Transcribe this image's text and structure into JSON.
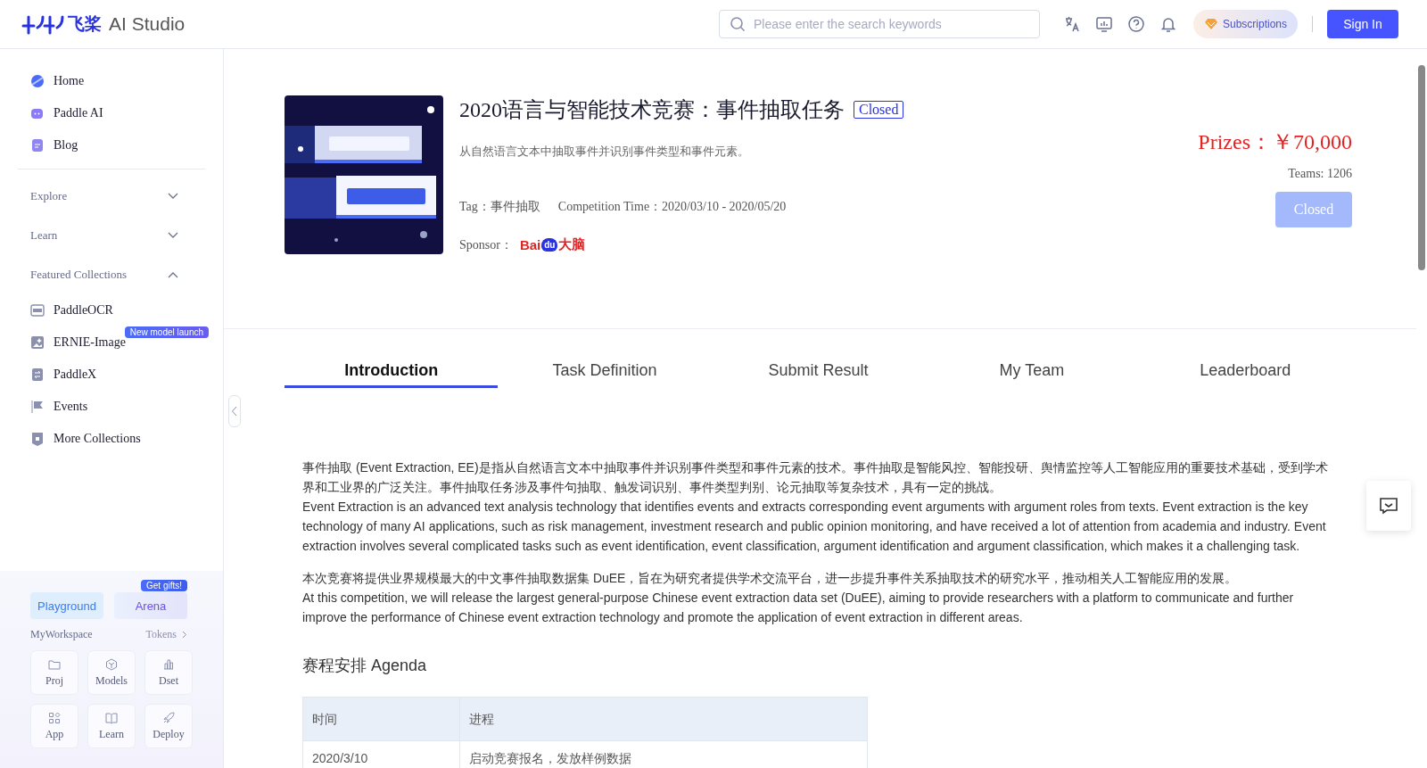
{
  "header": {
    "logo_cn": "飞桨",
    "logo_en": "AI Studio",
    "search": {
      "placeholder": "Please enter the search keywords"
    },
    "subscriptions": "Subscriptions",
    "sign_in": "Sign In"
  },
  "sidebar": {
    "items": [
      {
        "label": "Home"
      },
      {
        "label": "Paddle AI"
      },
      {
        "label": "Blog"
      }
    ],
    "sections": [
      {
        "label": "Explore",
        "expanded": false
      },
      {
        "label": "Learn",
        "expanded": false
      },
      {
        "label": "Featured Collections",
        "expanded": true,
        "items": [
          {
            "label": "PaddleOCR"
          },
          {
            "label": "ERNIE-Image",
            "badge": "New model launch"
          },
          {
            "label": "PaddleX"
          },
          {
            "label": "Events"
          },
          {
            "label": "More Collections"
          }
        ]
      }
    ],
    "playground": "Playground",
    "arena": "Arena",
    "arena_badge": "Get gifts!",
    "workspace": "MyWorkspace",
    "tokens": "Tokens",
    "tiles": [
      {
        "label": "Proj"
      },
      {
        "label": "Models"
      },
      {
        "label": "Dset"
      },
      {
        "label": "App"
      },
      {
        "label": "Learn"
      },
      {
        "label": "Deploy"
      }
    ]
  },
  "competition": {
    "title": "2020语言与智能技术竞赛：事件抽取任务",
    "status": "Closed",
    "description": "从自然语言文本中抽取事件并识别事件类型和事件元素。",
    "tag": "Tag：事件抽取",
    "time": "Competition Time：2020/03/10 - 2020/05/20",
    "sponsor_label": "Sponsor：",
    "sponsor_logo": [
      "Bai",
      "du",
      "大脑"
    ],
    "prizes": "Prizes：￥70,000",
    "teams": "Teams: 1206",
    "action": "Closed"
  },
  "tabs": [
    {
      "label": "Introduction",
      "selected": true
    },
    {
      "label": "Task Definition",
      "selected": false
    },
    {
      "label": "Submit Result",
      "selected": false
    },
    {
      "label": "My Team",
      "selected": false
    },
    {
      "label": "Leaderboard",
      "selected": false
    }
  ],
  "paragraphs": [
    "事件抽取 (Event Extraction, EE)是指从自然语言文本中抽取事件并识别事件类型和事件元素的技术。事件抽取是智能风控、智能投研、舆情监控等人工智能应用的重要技术基础，受到学术界和工业界的广泛关注。事件抽取任务涉及事件句抽取、触发词识别、事件类型判别、论元抽取等复杂技术，具有一定的挑战。",
    "Event Extraction is an advanced text analysis technology that identifies events and extracts corresponding event arguments with argument roles from texts. Event extraction is the key technology of many AI applications, such as risk management, investment research and public opinion monitoring, and have received a lot of attention from academia and industry. Event extraction involves several complicated tasks such as event identification, event classification, argument identification and argument classification, which makes it a challenging task.",
    "本次竞赛将提供业界规模最大的中文事件抽取数据集 DuEE，旨在为研究者提供学术交流平台，进一步提升事件关系抽取技术的研究水平，推动相关人工智能应用的发展。",
    "At this competition, we will release the largest general-purpose Chinese event extraction data set (DuEE), aiming to provide researchers with a platform to communicate and further improve the performance of Chinese event extraction technology and promote the application of event extraction in different areas."
  ],
  "agenda": {
    "title": "赛程安排 Agenda",
    "columns": [
      "时间",
      "进程"
    ],
    "rows": [
      [
        "2020/3/10",
        "启动竞赛报名，发放样例数据"
      ]
    ]
  }
}
